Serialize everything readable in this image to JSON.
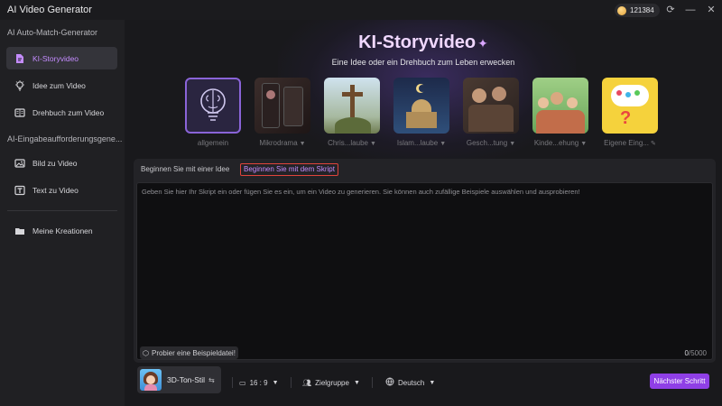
{
  "app": {
    "title": "AI Video Generator",
    "credits": "121384"
  },
  "window": {
    "refresh": "⟳",
    "minimize": "—",
    "close": "✕"
  },
  "sidebar": {
    "section1": "AI Auto-Match-Generator",
    "items1": [
      {
        "label": "KI-Storyvideo",
        "icon": "doc-sparkle-icon",
        "active": true
      },
      {
        "label": "Idee zum Video",
        "icon": "bulb-icon"
      },
      {
        "label": "Drehbuch zum Video",
        "icon": "book-icon"
      }
    ],
    "section2": "AI-Eingabeaufforderungsgene...",
    "items2": [
      {
        "label": "Bild zu Video",
        "icon": "image-icon"
      },
      {
        "label": "Text zu Video",
        "icon": "text-icon"
      }
    ],
    "items3": [
      {
        "label": "Meine Kreationen",
        "icon": "folder-icon"
      }
    ]
  },
  "hero": {
    "title": "KI-Storyvideo",
    "subtitle": "Eine Idee oder ein Drehbuch zum Leben erwecken"
  },
  "templates": [
    {
      "label": "allgemein",
      "selected": true,
      "dropdown": false
    },
    {
      "label": "Mikrodrama",
      "dropdown": true
    },
    {
      "label": "Chris...laube",
      "dropdown": true
    },
    {
      "label": "Islam...laube",
      "dropdown": true
    },
    {
      "label": "Gesch...tung",
      "dropdown": true
    },
    {
      "label": "Kinde...ehung",
      "dropdown": true
    },
    {
      "label": "Eigene Eing...",
      "dropdown": false,
      "edit": true
    }
  ],
  "tabs": {
    "idea": "Beginnen Sie mit einer Idee",
    "script": "Beginnen Sie mit dem Skript"
  },
  "editor": {
    "placeholder": "Geben Sie hier Ihr Skript ein oder fügen Sie es ein, um ein Video zu generieren. Sie können auch zufällige Beispiele auswählen und ausprobieren!",
    "sample_button": "Probier eine Beispieldatei!",
    "count": "0",
    "max": "/5000"
  },
  "toolbar": {
    "style": "3D-Ton-Stil",
    "ratio": "16 : 9",
    "audience": "Zielgruppe",
    "language": "Deutsch",
    "next": "Nächster Schritt"
  },
  "colors": {
    "accent": "#8f3fe6",
    "active_text": "#c48cff",
    "highlight_border": "#e0443c"
  }
}
